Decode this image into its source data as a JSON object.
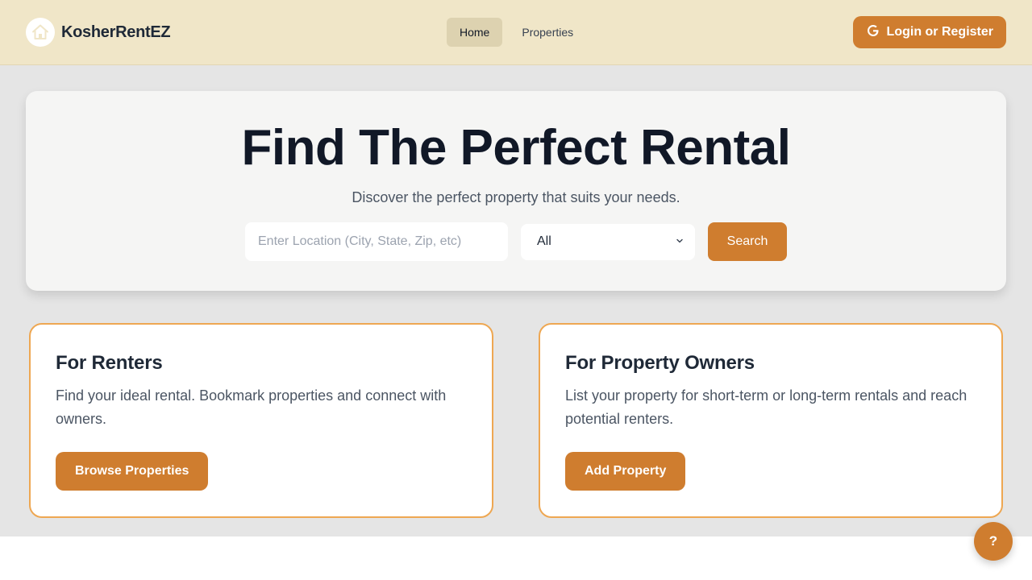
{
  "brand": {
    "name": "KosherRentEZ",
    "logo_icon": "house-icon"
  },
  "nav": {
    "items": [
      {
        "label": "Home",
        "active": true
      },
      {
        "label": "Properties",
        "active": false
      }
    ]
  },
  "auth": {
    "login_label": "Login or Register",
    "icon": "google-icon"
  },
  "hero": {
    "title": "Find The Perfect Rental",
    "subtitle": "Discover the perfect property that suits your needs.",
    "search": {
      "location_placeholder": "Enter Location (City, State, Zip, etc)",
      "location_value": "",
      "type_selected": "All",
      "button_label": "Search"
    }
  },
  "cards": {
    "renters": {
      "title": "For Renters",
      "text": "Find your ideal rental. Bookmark properties and connect with owners.",
      "button_label": "Browse Properties"
    },
    "owners": {
      "title": "For Property Owners",
      "text": "List your property for short-term or long-term rentals and reach potential renters.",
      "button_label": "Add Property"
    }
  },
  "help": {
    "label": "?"
  },
  "colors": {
    "accent": "#cf7d2f",
    "navbar_bg": "#f0e6c8",
    "card_border": "#eea752",
    "page_bg": "#e5e5e5"
  }
}
